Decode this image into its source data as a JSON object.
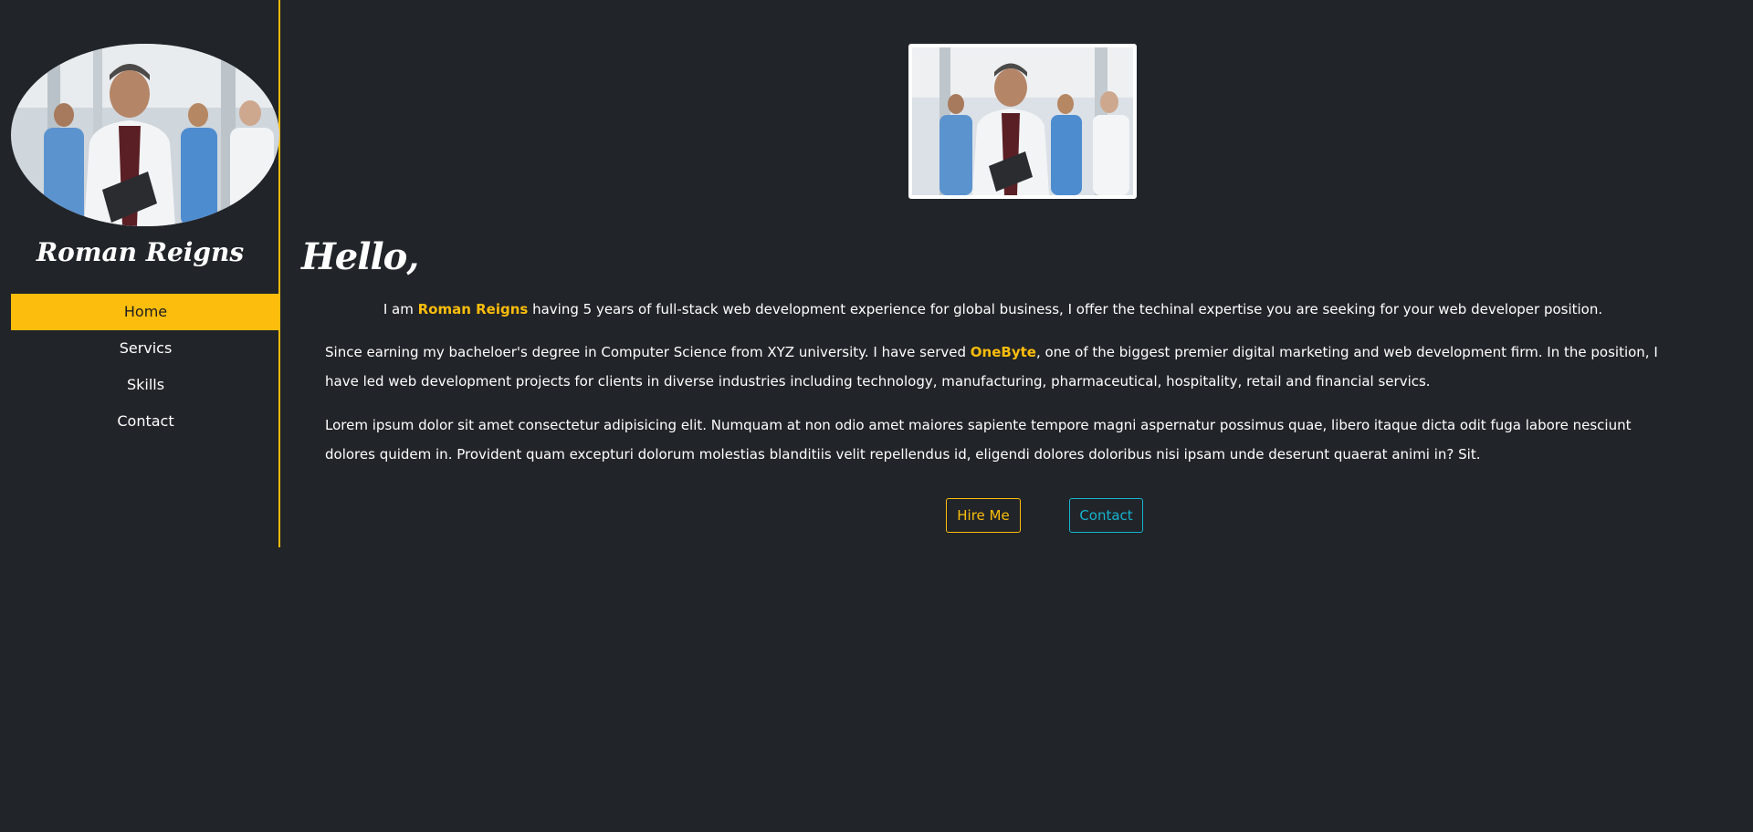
{
  "sidebar": {
    "name": "Roman Reigns",
    "nav": [
      {
        "label": "Home",
        "active": true
      },
      {
        "label": "Servics",
        "active": false
      },
      {
        "label": "Skills",
        "active": false
      },
      {
        "label": "Contact",
        "active": false
      }
    ]
  },
  "main": {
    "greeting": "Hello,",
    "intro": {
      "prefix": "I am ",
      "name": "Roman Reigns",
      "suffix": " having 5 years of full-stack web development experience for global business, I offer the techinal expertise you are seeking for your web developer position."
    },
    "experience": {
      "prefix": "Since earning my bacheloer's degree in Computer Science from XYZ university. I have served ",
      "company": "OneByte",
      "suffix": ", one of the biggest premier digital marketing and web development firm. In the position, I have led web development projects for clients in diverse industries including technology, manufacturing, pharmaceutical, hospitality, retail and financial servics."
    },
    "lorem": "Lorem ipsum dolor sit amet consectetur adipisicing elit. Numquam at non odio amet maiores sapiente tempore magni aspernatur possimus quae, libero itaque dicta odit fuga labore nesciunt dolores quidem in. Provident quam excepturi dolorum molestias blanditiis velit repellendus id, eligendi dolores doloribus nisi ipsam unde deserunt quaerat animi in? Sit.",
    "hire_button": "Hire Me",
    "contact_button": "Contact"
  },
  "colors": {
    "background": "#212429",
    "accent": "#fcbd0c",
    "contact_accent": "#16b3cf"
  }
}
